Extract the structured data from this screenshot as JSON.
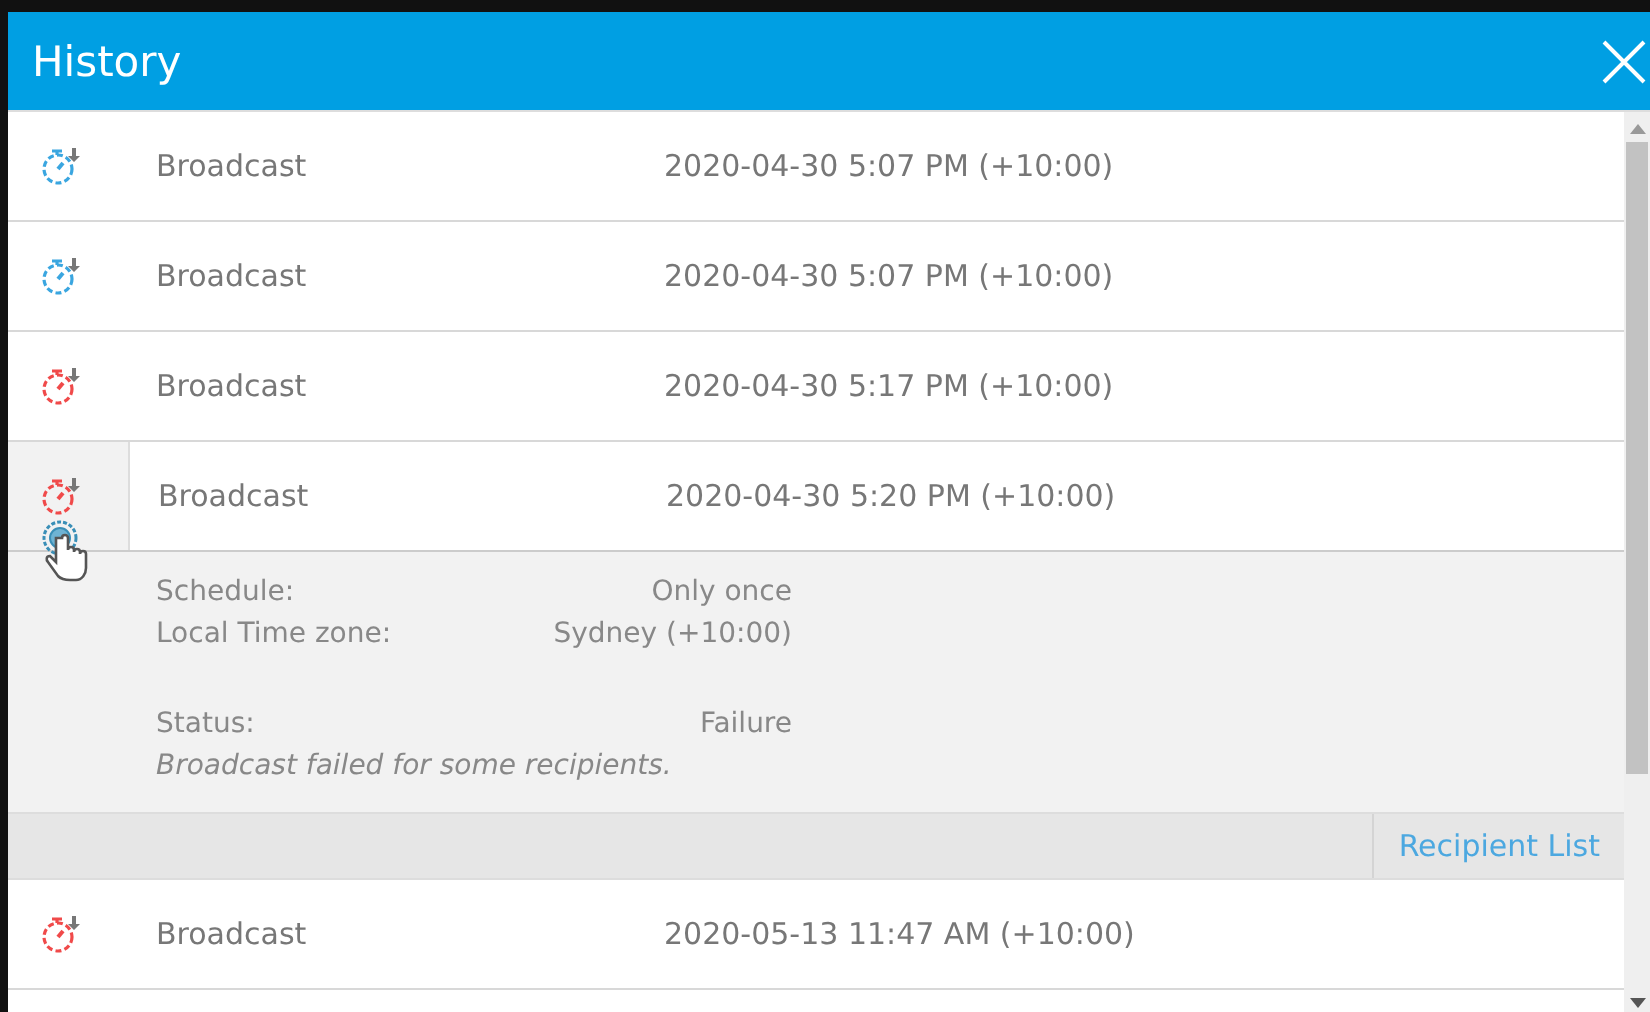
{
  "window": {
    "title": "History"
  },
  "rows": [
    {
      "name": "Broadcast",
      "time": "2020-04-30 5:07 PM (+10:00)",
      "color": "#3aa6e0",
      "expanded": false
    },
    {
      "name": "Broadcast",
      "time": "2020-04-30 5:07 PM (+10:00)",
      "color": "#3aa6e0",
      "expanded": false
    },
    {
      "name": "Broadcast",
      "time": "2020-04-30 5:17 PM (+10:00)",
      "color": "#f04a4a",
      "expanded": false
    },
    {
      "name": "Broadcast",
      "time": "2020-04-30 5:20 PM (+10:00)",
      "color": "#f04a4a",
      "expanded": true,
      "details": {
        "fields": [
          {
            "label": "Schedule:",
            "value": "Only once"
          },
          {
            "label": "Local Time zone:",
            "value": "Sydney (+10:00)"
          },
          {
            "label": "Status:",
            "value": "Failure",
            "gap": true
          }
        ],
        "message": "Broadcast failed for some recipients.",
        "action": "Recipient List"
      }
    },
    {
      "name": "Broadcast",
      "time": "2020-05-13 11:47 AM (+10:00)",
      "color": "#f04a4a",
      "expanded": false
    }
  ]
}
